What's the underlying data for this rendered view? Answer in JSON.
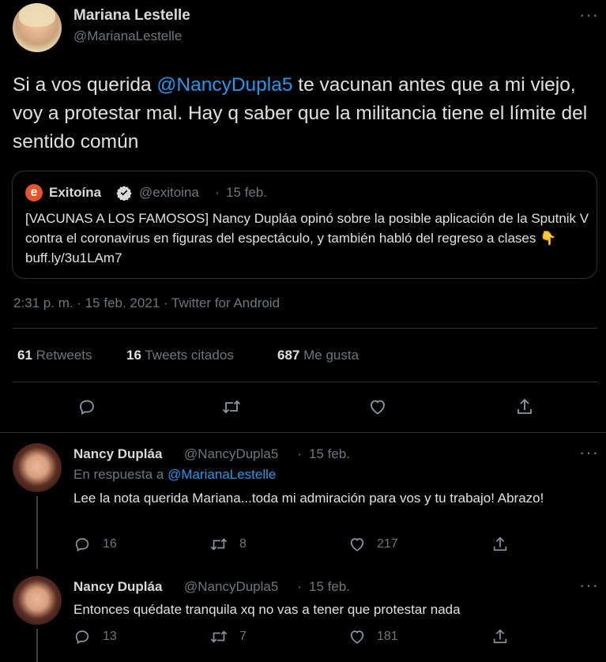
{
  "main_tweet": {
    "author_name": "Mariana Lestelle",
    "author_handle": "@MarianaLestelle",
    "text_before": "Si a vos querida ",
    "mention": "@NancyDupla5",
    "text_after": " te vacunan antes que a mi viejo, voy a protestar mal. Hay q saber que la militancia tiene el límite del sentido común",
    "quote": {
      "author_name": "Exitoína",
      "author_handle": "@exitoina",
      "separator": "·",
      "date": "15 feb.",
      "text": "[VACUNAS A LOS FAMOSOS] Nancy Dupláa opinó sobre la posible aplicación de la Sputnik V contra el coronavirus en figuras del espectáculo, y también habló del regreso a clases",
      "emoji": "👇",
      "link": "buff.ly/3u1LAm7"
    },
    "timestamp": "2:31 p. m. · 15 feb. 2021 · Twitter for Android",
    "stats": {
      "retweets_count": "61",
      "retweets_label": "Retweets",
      "quotes_count": "16",
      "quotes_label": "Tweets citados",
      "likes_count": "687",
      "likes_label": "Me gusta"
    }
  },
  "replies": [
    {
      "author_name": "Nancy Dupláa",
      "author_handle": "@NancyDupla5",
      "separator": "·",
      "date": "15 feb.",
      "reply_to_label": "En respuesta a",
      "reply_to_handle": "@MarianaLestelle",
      "text": "Lee la nota querida Mariana...toda mi admiración para vos y tu trabajo! Abrazo!",
      "replies_count": "16",
      "retweets_count": "8",
      "likes_count": "217"
    },
    {
      "author_name": "Nancy Dupláa",
      "author_handle": "@NancyDupla5",
      "separator": "·",
      "date": "15 feb.",
      "text": "Entonces quédate tranquila xq no vas a tener que protestar nada",
      "replies_count": "13",
      "retweets_count": "7",
      "likes_count": "181"
    }
  ],
  "more_glyph": "···",
  "colors": {
    "background": "#000000",
    "text": "#d9d9d9",
    "muted": "#6e767d",
    "link": "#1d9bf0",
    "divider": "#2f3336",
    "verified": "#d9d9d9",
    "exitoina_logo": "#e8532b"
  },
  "icons": [
    "reply-icon",
    "retweet-icon",
    "like-icon",
    "share-icon",
    "more-icon",
    "verified-icon",
    "exitoina-logo-icon"
  ]
}
